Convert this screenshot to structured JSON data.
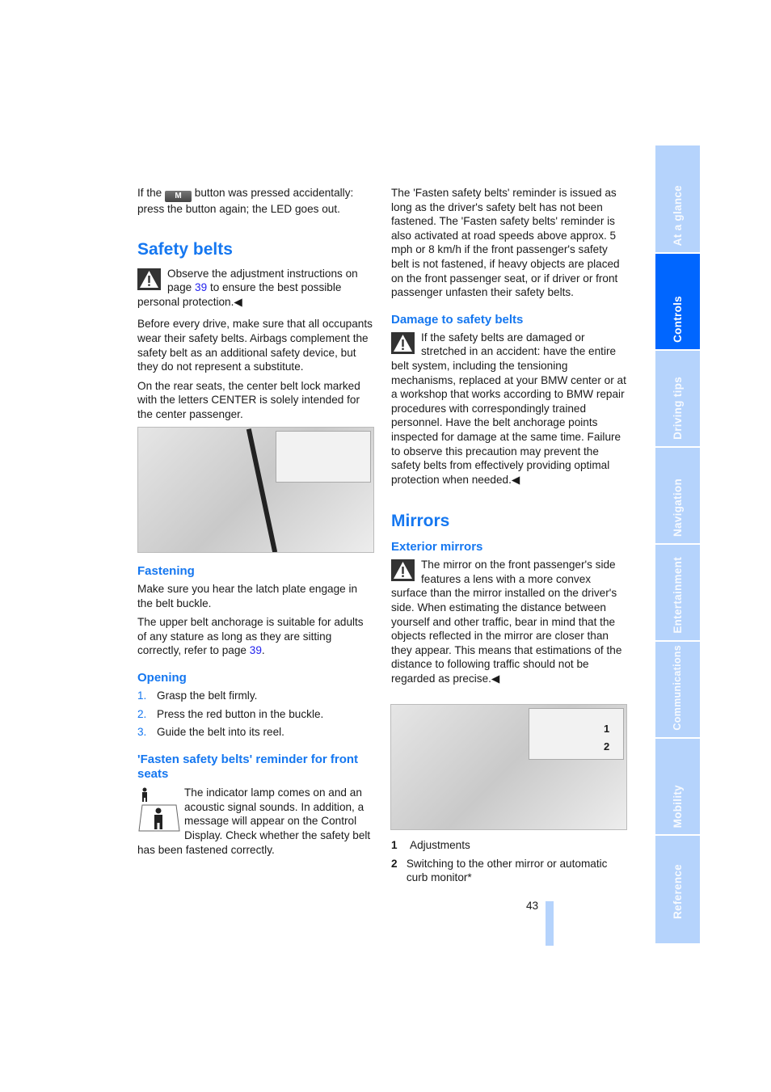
{
  "left": {
    "intro": {
      "pre": "If the",
      "button": "M",
      "post": "button was pressed accidentally: press the button again; the LED goes out."
    },
    "safety_title": "Safety belts",
    "warning": {
      "pre": "Observe the adjustment instructions on page",
      "page": "39",
      "post": "to ensure the best possible personal protection.◀"
    },
    "p1": "Before every drive, make sure that all occupants wear their safety belts. Airbags complement the safety belt as an additional safety device, but they do not represent a substitute.",
    "p2": "On the rear seats, the center belt lock marked with the letters CENTER is solely intended for the center passenger.",
    "fastening_title": "Fastening",
    "f1": "Make sure you hear the latch plate engage in the belt buckle.",
    "f2": {
      "pre": "The upper belt anchorage is suitable for adults of any stature as long as they are sitting correctly, refer to page",
      "page": "39",
      "post": "."
    },
    "opening_title": "Opening",
    "steps": [
      {
        "n": "1.",
        "t": "Grasp the belt firmly."
      },
      {
        "n": "2.",
        "t": "Press the red button in the buckle."
      },
      {
        "n": "3.",
        "t": "Guide the belt into its reel."
      }
    ],
    "reminder_title": "'Fasten safety belts' reminder for front seats",
    "reminder_text": "The indicator lamp comes on and an acoustic signal sounds. In addition, a message will appear on the Control Display. Check whether the safety belt has been fastened correctly."
  },
  "right": {
    "p1": "The 'Fasten safety belts' reminder is issued as long as the driver's safety belt has not been fastened. The 'Fasten safety belts' reminder is also activated at road speeds above approx. 5 mph or 8 km/h if the front passenger's safety belt is not fastened, if heavy objects are placed on the front passenger seat, or if driver or front passenger unfasten their safety belts.",
    "damage_title": "Damage to safety belts",
    "damage_text": "If the safety belts are damaged or stretched in an accident: have the entire belt system, including the tensioning mechanisms, replaced at your BMW center or at a workshop that works according to BMW repair procedures with correspondingly trained personnel. Have the belt anchorage points inspected for damage at the same time. Failure to observe this precaution may prevent the safety belts from effectively providing optimal protection when needed.◀",
    "mirrors_title": "Mirrors",
    "exterior_title": "Exterior mirrors",
    "exterior_text": "The mirror on the front passenger's side features a lens with a more convex surface than the mirror installed on the driver's side. When estimating the distance between yourself and other traffic, bear in mind that the objects reflected in the mirror are closer than they appear. This means that estimations of the distance to following traffic should not be regarded as precise.◀",
    "callouts": [
      "1",
      "2"
    ],
    "captions": [
      {
        "n": "1",
        "t": "Adjustments"
      },
      {
        "n": "2",
        "t": "Switching to the other mirror or automatic curb monitor*"
      }
    ]
  },
  "page_number": "43",
  "tabs": [
    "At a glance",
    "Controls",
    "Driving tips",
    "Navigation",
    "Entertainment",
    "Communications",
    "Mobility",
    "Reference"
  ],
  "active_tab": "Controls",
  "colors": {
    "heading": "#1577f0",
    "tab": "#b5d3fc",
    "tab_active": "#0066ff",
    "link": "#2222ee"
  }
}
